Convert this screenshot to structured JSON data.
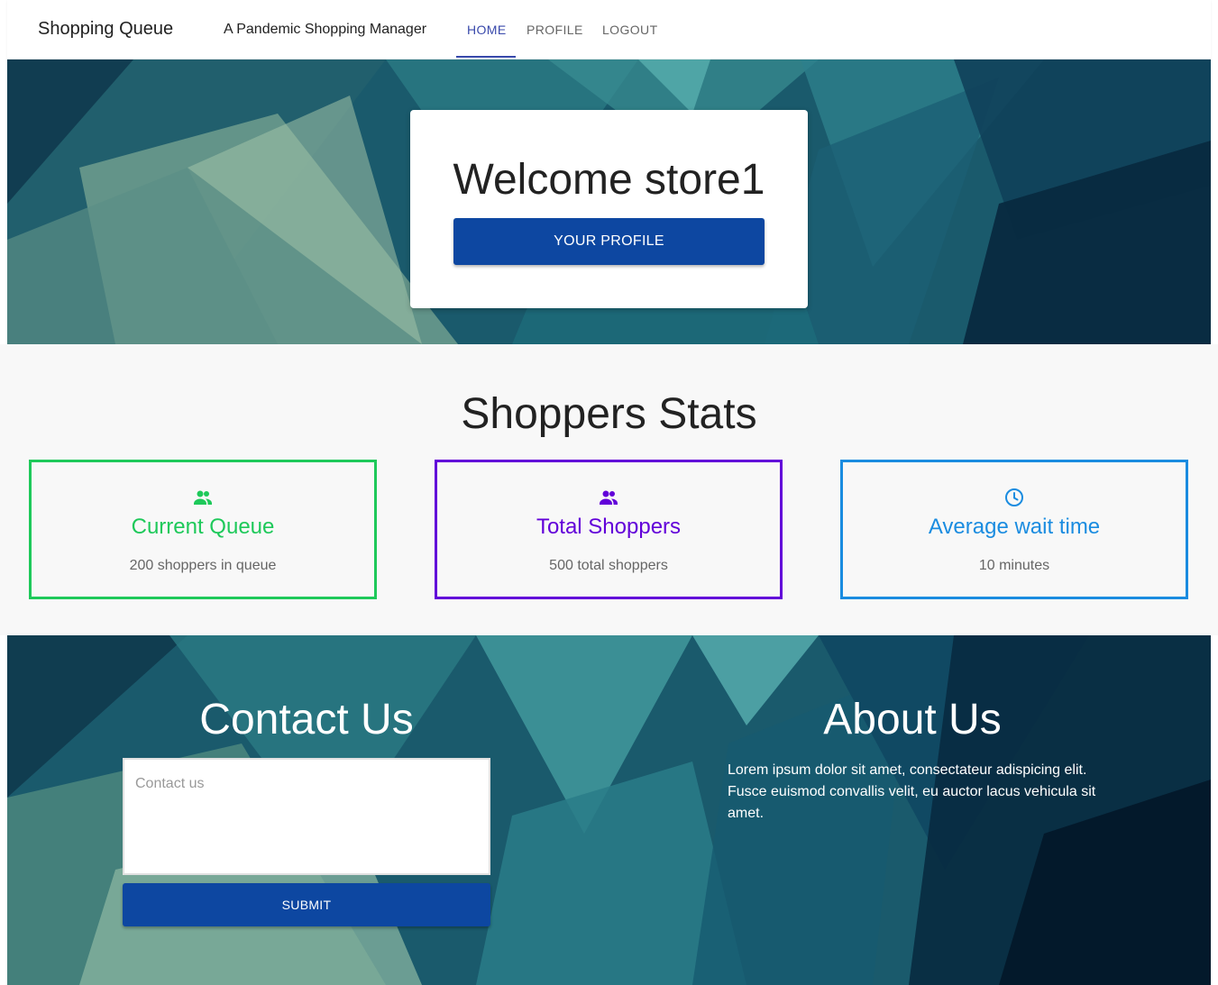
{
  "nav": {
    "brand": "Shopping Queue",
    "tagline": "A Pandemic Shopping Manager",
    "tabs": [
      {
        "label": "HOME",
        "active": true
      },
      {
        "label": "PROFILE",
        "active": false
      },
      {
        "label": "LOGOUT",
        "active": false
      }
    ]
  },
  "hero": {
    "welcome": "Welcome store1",
    "profile_button": "YOUR PROFILE"
  },
  "stats": {
    "heading": "Shoppers Stats",
    "cards": [
      {
        "icon": "people-icon",
        "title": "Current Queue",
        "value": "200 shoppers in queue",
        "color": "#1ec95a"
      },
      {
        "icon": "people-icon",
        "title": "Total Shoppers",
        "value": "500 total shoppers",
        "color": "#6200d9"
      },
      {
        "icon": "clock-icon",
        "title": "Average wait time",
        "value": "10 minutes",
        "color": "#1a8ce0"
      }
    ]
  },
  "footer": {
    "contact": {
      "heading": "Contact Us",
      "placeholder": "Contact us",
      "submit": "SUBMIT"
    },
    "about": {
      "heading": "About Us",
      "text": "Lorem ipsum dolor sit amet, consectateur adispicing elit. Fusce euismod convallis velit, eu auctor lacus vehicula sit amet."
    }
  },
  "colors": {
    "primary_button": "#0d47a1",
    "nav_active": "#3949ab"
  }
}
